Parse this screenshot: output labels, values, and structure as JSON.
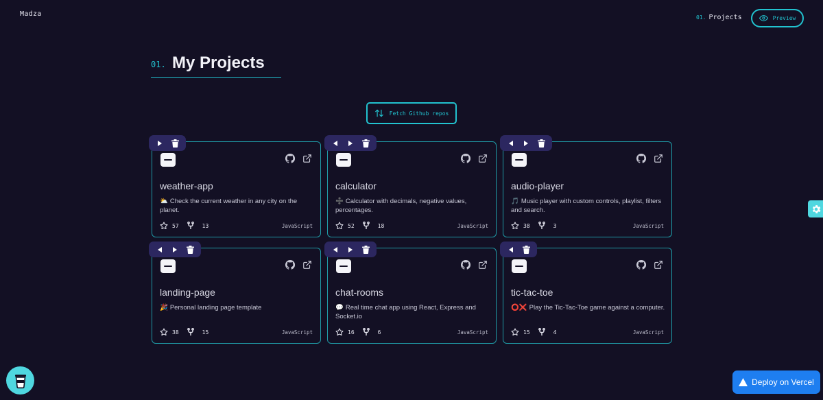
{
  "header": {
    "brand": "Madza",
    "nav_projects_num": "01.",
    "nav_projects_label": "Projects",
    "preview_label": "Preview"
  },
  "section": {
    "num": "01.",
    "title": "My Projects"
  },
  "fetch_button": "Fetch Github repos",
  "cards": [
    {
      "name": "weather-app",
      "emoji": "⛅",
      "desc": "Check the current weather in any city on the planet.",
      "stars": "57",
      "forks": "13",
      "lang": "JavaScript",
      "toolbar": [
        "right",
        "delete"
      ]
    },
    {
      "name": "calculator",
      "emoji": "➗",
      "desc": "Calculator with decimals, negative values, percentages.",
      "stars": "52",
      "forks": "18",
      "lang": "JavaScript",
      "toolbar": [
        "left",
        "right",
        "delete"
      ]
    },
    {
      "name": "audio-player",
      "emoji": "🎵",
      "desc": "Music player with custom controls, playlist, filters and search.",
      "stars": "38",
      "forks": "3",
      "lang": "JavaScript",
      "toolbar": [
        "left",
        "right",
        "delete"
      ]
    },
    {
      "name": "landing-page",
      "emoji": "🎉",
      "desc": "Personal landing page template",
      "stars": "38",
      "forks": "15",
      "lang": "JavaScript",
      "toolbar": [
        "left",
        "right",
        "delete"
      ]
    },
    {
      "name": "chat-rooms",
      "emoji": "💬",
      "desc": "Real time chat app using React, Express and Socket.io",
      "stars": "16",
      "forks": "6",
      "lang": "JavaScript",
      "toolbar": [
        "left",
        "right",
        "delete"
      ]
    },
    {
      "name": "tic-tac-toe",
      "emoji": "⭕❌",
      "desc": "Play the Tic-Tac-Toe game against a computer.",
      "stars": "15",
      "forks": "4",
      "lang": "JavaScript",
      "toolbar": [
        "left",
        "delete"
      ]
    }
  ],
  "deploy_button": "Deploy on Vercel",
  "icons": {
    "preview": "eye-icon",
    "fetch": "swap-vertical-icon",
    "settings": "gear-icon",
    "coffee": "coffee-cup-icon",
    "deploy": "triangle-icon",
    "repo": "github-icon",
    "external": "external-link-icon",
    "folder": "folder-icon",
    "stars": "star-icon",
    "forks": "fork-icon"
  },
  "colors": {
    "background": "#131024",
    "accent": "#22c3d0",
    "card_border": "#1f9aa6",
    "toolbar": "#2c2760",
    "fab": "#4fd7e0",
    "deploy": "#1e7ef0"
  }
}
